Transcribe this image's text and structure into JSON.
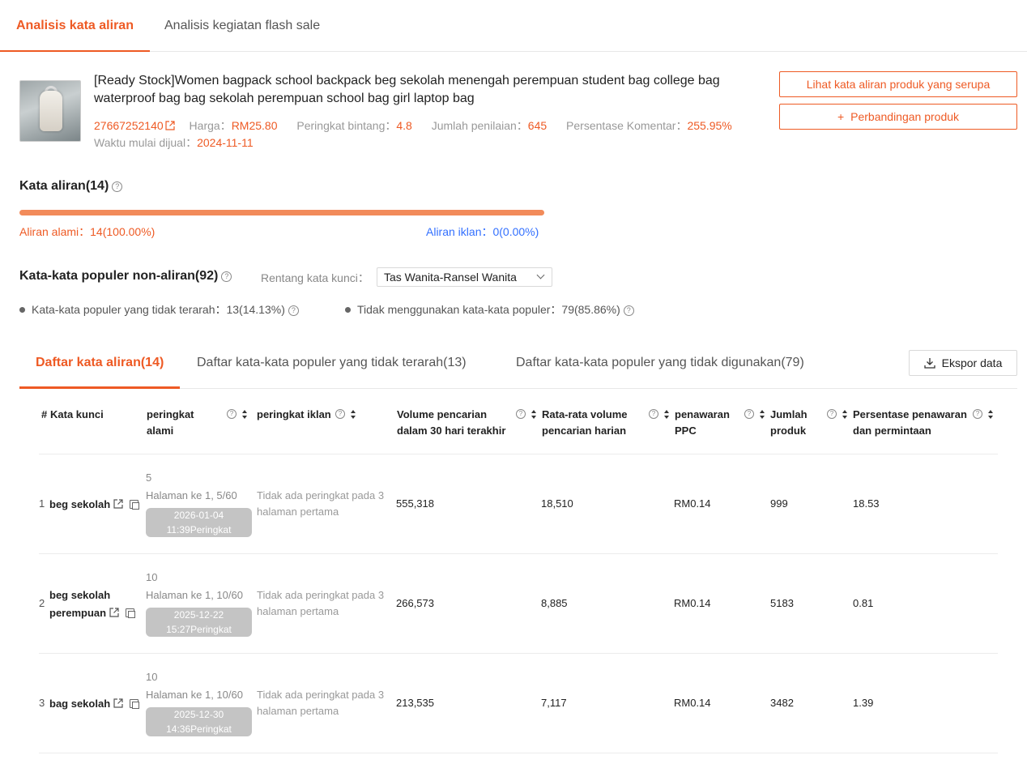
{
  "top_tabs": [
    {
      "label": "Analisis kata aliran",
      "active": true
    },
    {
      "label": "Analisis kegiatan flash sale",
      "active": false
    }
  ],
  "product": {
    "title": "[Ready Stock]Women bagpack school backpack beg sekolah menengah perempuan student bag college bag waterproof bag bag sekolah perempuan school bag girl laptop bag",
    "id": "27667252140",
    "price_label": "Harga：",
    "price": "RM25.80",
    "rating_label": "Peringkat bintang：",
    "rating": "4.8",
    "reviews_label": "Jumlah penilaian：",
    "reviews": "645",
    "comment_label": "Persentase Komentar：",
    "comment": "255.95%",
    "start_label": "Waktu mulai dijual：",
    "start": "2024-11-11",
    "btn_similar": "Lihat kata aliran produk yang serupa",
    "btn_compare": "Perbandingan produk",
    "btn_compare_prefix": "+"
  },
  "flow": {
    "title": "Kata aliran(14)",
    "natural": "Aliran alami：14(100.00%)",
    "ad": "Aliran iklan：0(0.00%)",
    "natural_fraction": 1.0
  },
  "popular": {
    "title": "Kata-kata populer non-aliran(92)",
    "range_label": "Rentang kata kunci：",
    "range_value": "Tas Wanita-Ransel Wanita",
    "untargeted": "Kata-kata populer yang tidak terarah：13(14.13%)",
    "unused": "Tidak menggunakan kata-kata populer：79(85.86%)"
  },
  "list_tabs": [
    {
      "label": "Daftar kata aliran(14)",
      "active": true
    },
    {
      "label": "Daftar kata-kata populer yang tidak terarah(13)",
      "active": false
    },
    {
      "label": "Daftar kata-kata populer yang tidak digunakan(79)",
      "active": false
    }
  ],
  "export_label": "Ekspor data",
  "table": {
    "headers": {
      "num": "#",
      "keyword": "Kata kunci",
      "natural_1": "peringkat",
      "natural_2": "alami",
      "ad": "peringkat iklan",
      "vol_1": "Volume pencarian",
      "vol_2": "dalam 30 hari terakhir",
      "daily_1": "Rata-rata volume",
      "daily_2": "pencarian harian",
      "ppc_1": "penawaran",
      "ppc_2": "PPC",
      "prod_1": "Jumlah",
      "prod_2": "produk",
      "ratio_1": "Persentase penawaran",
      "ratio_2": "dan permintaan"
    },
    "rows": [
      {
        "idx": "1",
        "keyword": "beg sekolah",
        "rank": "5",
        "page": "Halaman ke 1, 5/60",
        "badge_1": "2026-01-04",
        "badge_2": "11:39Peringkat",
        "ad_1": "Tidak ada peringkat pada 3",
        "ad_2": "halaman pertama",
        "volume": "555,318",
        "daily": "18,510",
        "ppc": "RM0.14",
        "products": "999",
        "ratio": "18.53"
      },
      {
        "idx": "2",
        "keyword_1": "beg sekolah",
        "keyword_2": "perempuan",
        "rank": "10",
        "page": "Halaman ke 1, 10/60",
        "badge_1": "2025-12-22",
        "badge_2": "15:27Peringkat",
        "ad_1": "Tidak ada peringkat pada 3",
        "ad_2": "halaman pertama",
        "volume": "266,573",
        "daily": "8,885",
        "ppc": "RM0.14",
        "products": "5183",
        "ratio": "0.81"
      },
      {
        "idx": "3",
        "keyword": "bag sekolah",
        "rank": "10",
        "page": "Halaman ke 1, 10/60",
        "badge_1": "2025-12-30",
        "badge_2": "14:36Peringkat",
        "ad_1": "Tidak ada peringkat pada 3",
        "ad_2": "halaman pertama",
        "volume": "213,535",
        "daily": "7,117",
        "ppc": "RM0.14",
        "products": "3482",
        "ratio": "1.39"
      }
    ]
  },
  "colors": {
    "accent": "#ee5a24",
    "ad_blue": "#3370ff",
    "bar": "#f28b5a",
    "badge": "#c4c4c4"
  }
}
